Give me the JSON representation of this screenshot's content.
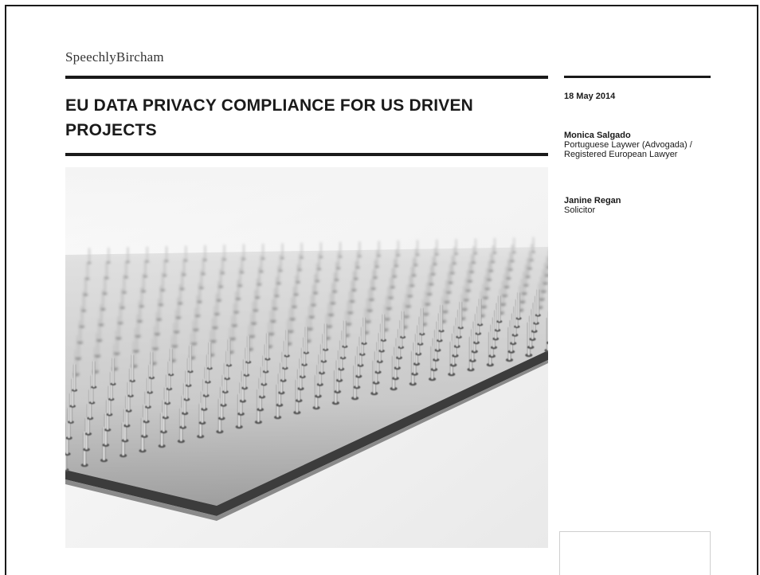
{
  "header": {
    "logo_text": "SpeechlyBircham"
  },
  "document": {
    "title": "EU DATA PRIVACY COMPLIANCE FOR US DRIVEN PROJECTS",
    "date": "18 May 2014",
    "authors": [
      {
        "name": "Monica Salgado",
        "role": "Portuguese Laywer (Advogada) / Registered European Lawyer"
      },
      {
        "name": "Janine Regan",
        "role": "Solicitor"
      }
    ]
  },
  "hero_image": {
    "subject": "microprocessor-pins-photo"
  },
  "colors": {
    "text": "#1a1a1a",
    "rule": "#1a1a1a",
    "background": "#ffffff"
  }
}
